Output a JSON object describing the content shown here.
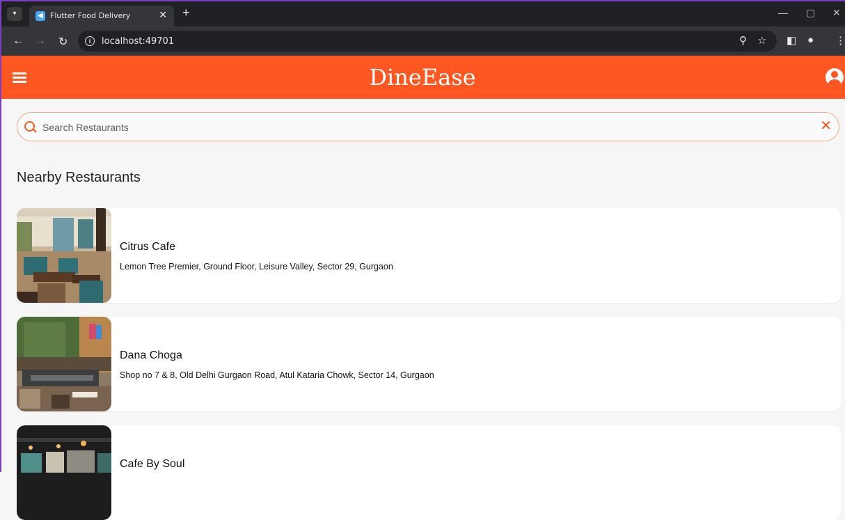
{
  "browser": {
    "tab_title": "Flutter Food Delivery",
    "url": "localhost:49701"
  },
  "app": {
    "title": "DineEase",
    "brand_color": "#ff5722"
  },
  "search": {
    "placeholder": "Search Restaurants",
    "value": ""
  },
  "section_title": "Nearby Restaurants",
  "restaurants": [
    {
      "name": "Citrus Cafe",
      "address": "Lemon Tree Premier, Ground Floor, Leisure Valley, Sector 29, Gurgaon"
    },
    {
      "name": "Dana Choga",
      "address": "Shop no 7 & 8, Old Delhi Gurgaon Road, Atul Kataria Chowk, Sector 14, Gurgaon"
    },
    {
      "name": "Cafe By Soul",
      "address": ""
    }
  ]
}
